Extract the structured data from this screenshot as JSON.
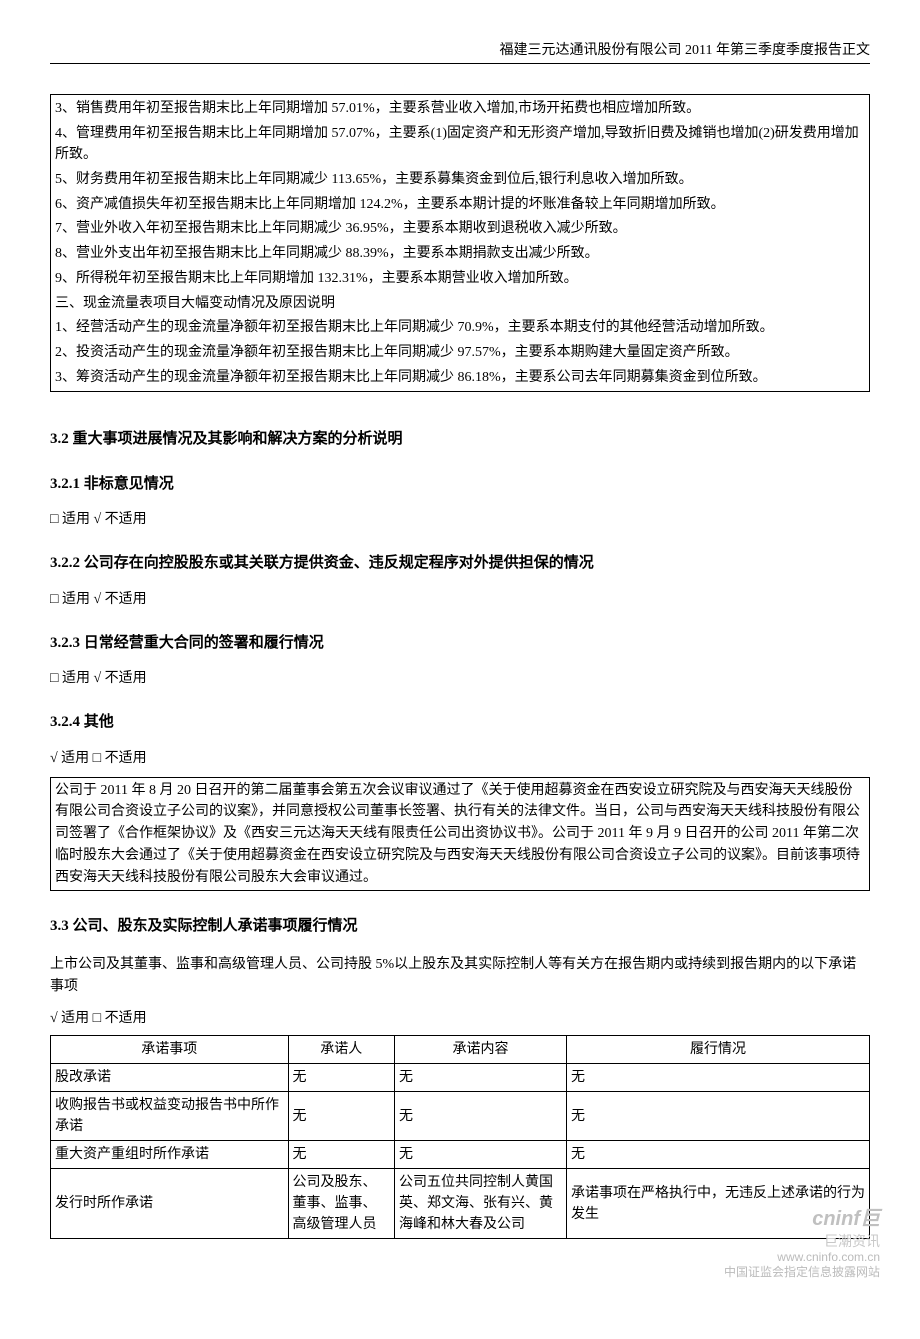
{
  "header": "福建三元达通讯股份有限公司 2011 年第三季度季度报告正文",
  "box1": {
    "l3": "3、销售费用年初至报告期末比上年同期增加 57.01%，主要系营业收入增加,市场开拓费也相应增加所致。",
    "l4": "4、管理费用年初至报告期末比上年同期增加 57.07%，主要系(1)固定资产和无形资产增加,导致折旧费及摊销也增加(2)研发费用增加所致。",
    "l5": "5、财务费用年初至报告期末比上年同期减少 113.65%，主要系募集资金到位后,银行利息收入增加所致。",
    "l6": "6、资产减值损失年初至报告期末比上年同期增加 124.2%，主要系本期计提的坏账准备较上年同期增加所致。",
    "l7": "7、营业外收入年初至报告期末比上年同期减少 36.95%，主要系本期收到退税收入减少所致。",
    "l8": "8、营业外支出年初至报告期末比上年同期减少 88.39%，主要系本期捐款支出减少所致。",
    "l9": "9、所得税年初至报告期末比上年同期增加 132.31%，主要系本期营业收入增加所致。",
    "l10": "三、现金流量表项目大幅变动情况及原因说明",
    "l11": "1、经营活动产生的现金流量净额年初至报告期末比上年同期减少 70.9%，主要系本期支付的其他经营活动增加所致。",
    "l12": "2、投资活动产生的现金流量净额年初至报告期末比上年同期减少 97.57%，主要系本期购建大量固定资产所致。",
    "l13": "3、筹资活动产生的现金流量净额年初至报告期末比上年同期减少 86.18%，主要系公司去年同期募集资金到位所致。"
  },
  "s32": "3.2 重大事项进展情况及其影响和解决方案的分析说明",
  "s321": "3.2.1 非标意见情况",
  "apply_no": "□ 适用  √ 不适用",
  "s322": "3.2.2 公司存在向控股股东或其关联方提供资金、违反规定程序对外提供担保的情况",
  "s323": "3.2.3 日常经营重大合同的签署和履行情况",
  "s324": "3.2.4 其他",
  "apply_yes": "√ 适用  □ 不适用",
  "box2": "公司于 2011 年 8 月 20 日召开的第二届董事会第五次会议审议通过了《关于使用超募资金在西安设立研究院及与西安海天天线股份有限公司合资设立子公司的议案》，并同意授权公司董事长签署、执行有关的法律文件。当日，公司与西安海天天线科技股份有限公司签署了《合作框架协议》及《西安三元达海天天线有限责任公司出资协议书》。公司于 2011 年 9 月 9 日召开的公司 2011 年第二次临时股东大会通过了《关于使用超募资金在西安设立研究院及与西安海天天线股份有限公司合资设立子公司的议案》。目前该事项待西安海天天线科技股份有限公司股东大会审议通过。",
  "s33": "3.3 公司、股东及实际控制人承诺事项履行情况",
  "para33": "上市公司及其董事、监事和高级管理人员、公司持股 5%以上股东及其实际控制人等有关方在报告期内或持续到报告期内的以下承诺事项",
  "table": {
    "h1": "承诺事项",
    "h2": "承诺人",
    "h3": "承诺内容",
    "h4": "履行情况",
    "r1c1": "股改承诺",
    "r1c2": "无",
    "r1c3": "无",
    "r1c4": "无",
    "r2c1": "收购报告书或权益变动报告书中所作承诺",
    "r2c2": "无",
    "r2c3": "无",
    "r2c4": "无",
    "r3c1": "重大资产重组时所作承诺",
    "r3c2": "无",
    "r3c3": "无",
    "r3c4": "无",
    "r4c1": "发行时所作承诺",
    "r4c2": "公司及股东、董事、监事、高级管理人员",
    "r4c3": "公司五位共同控制人黄国英、郑文海、张有兴、黄海峰和林大春及公司",
    "r4c4": "承诺事项在严格执行中，无违反上述承诺的行为发生"
  },
  "wm": {
    "logo": "cninf",
    "cn": "巨潮资讯",
    "url": "www.cninfo.com.cn",
    "desc": "中国证监会指定信息披露网站"
  }
}
